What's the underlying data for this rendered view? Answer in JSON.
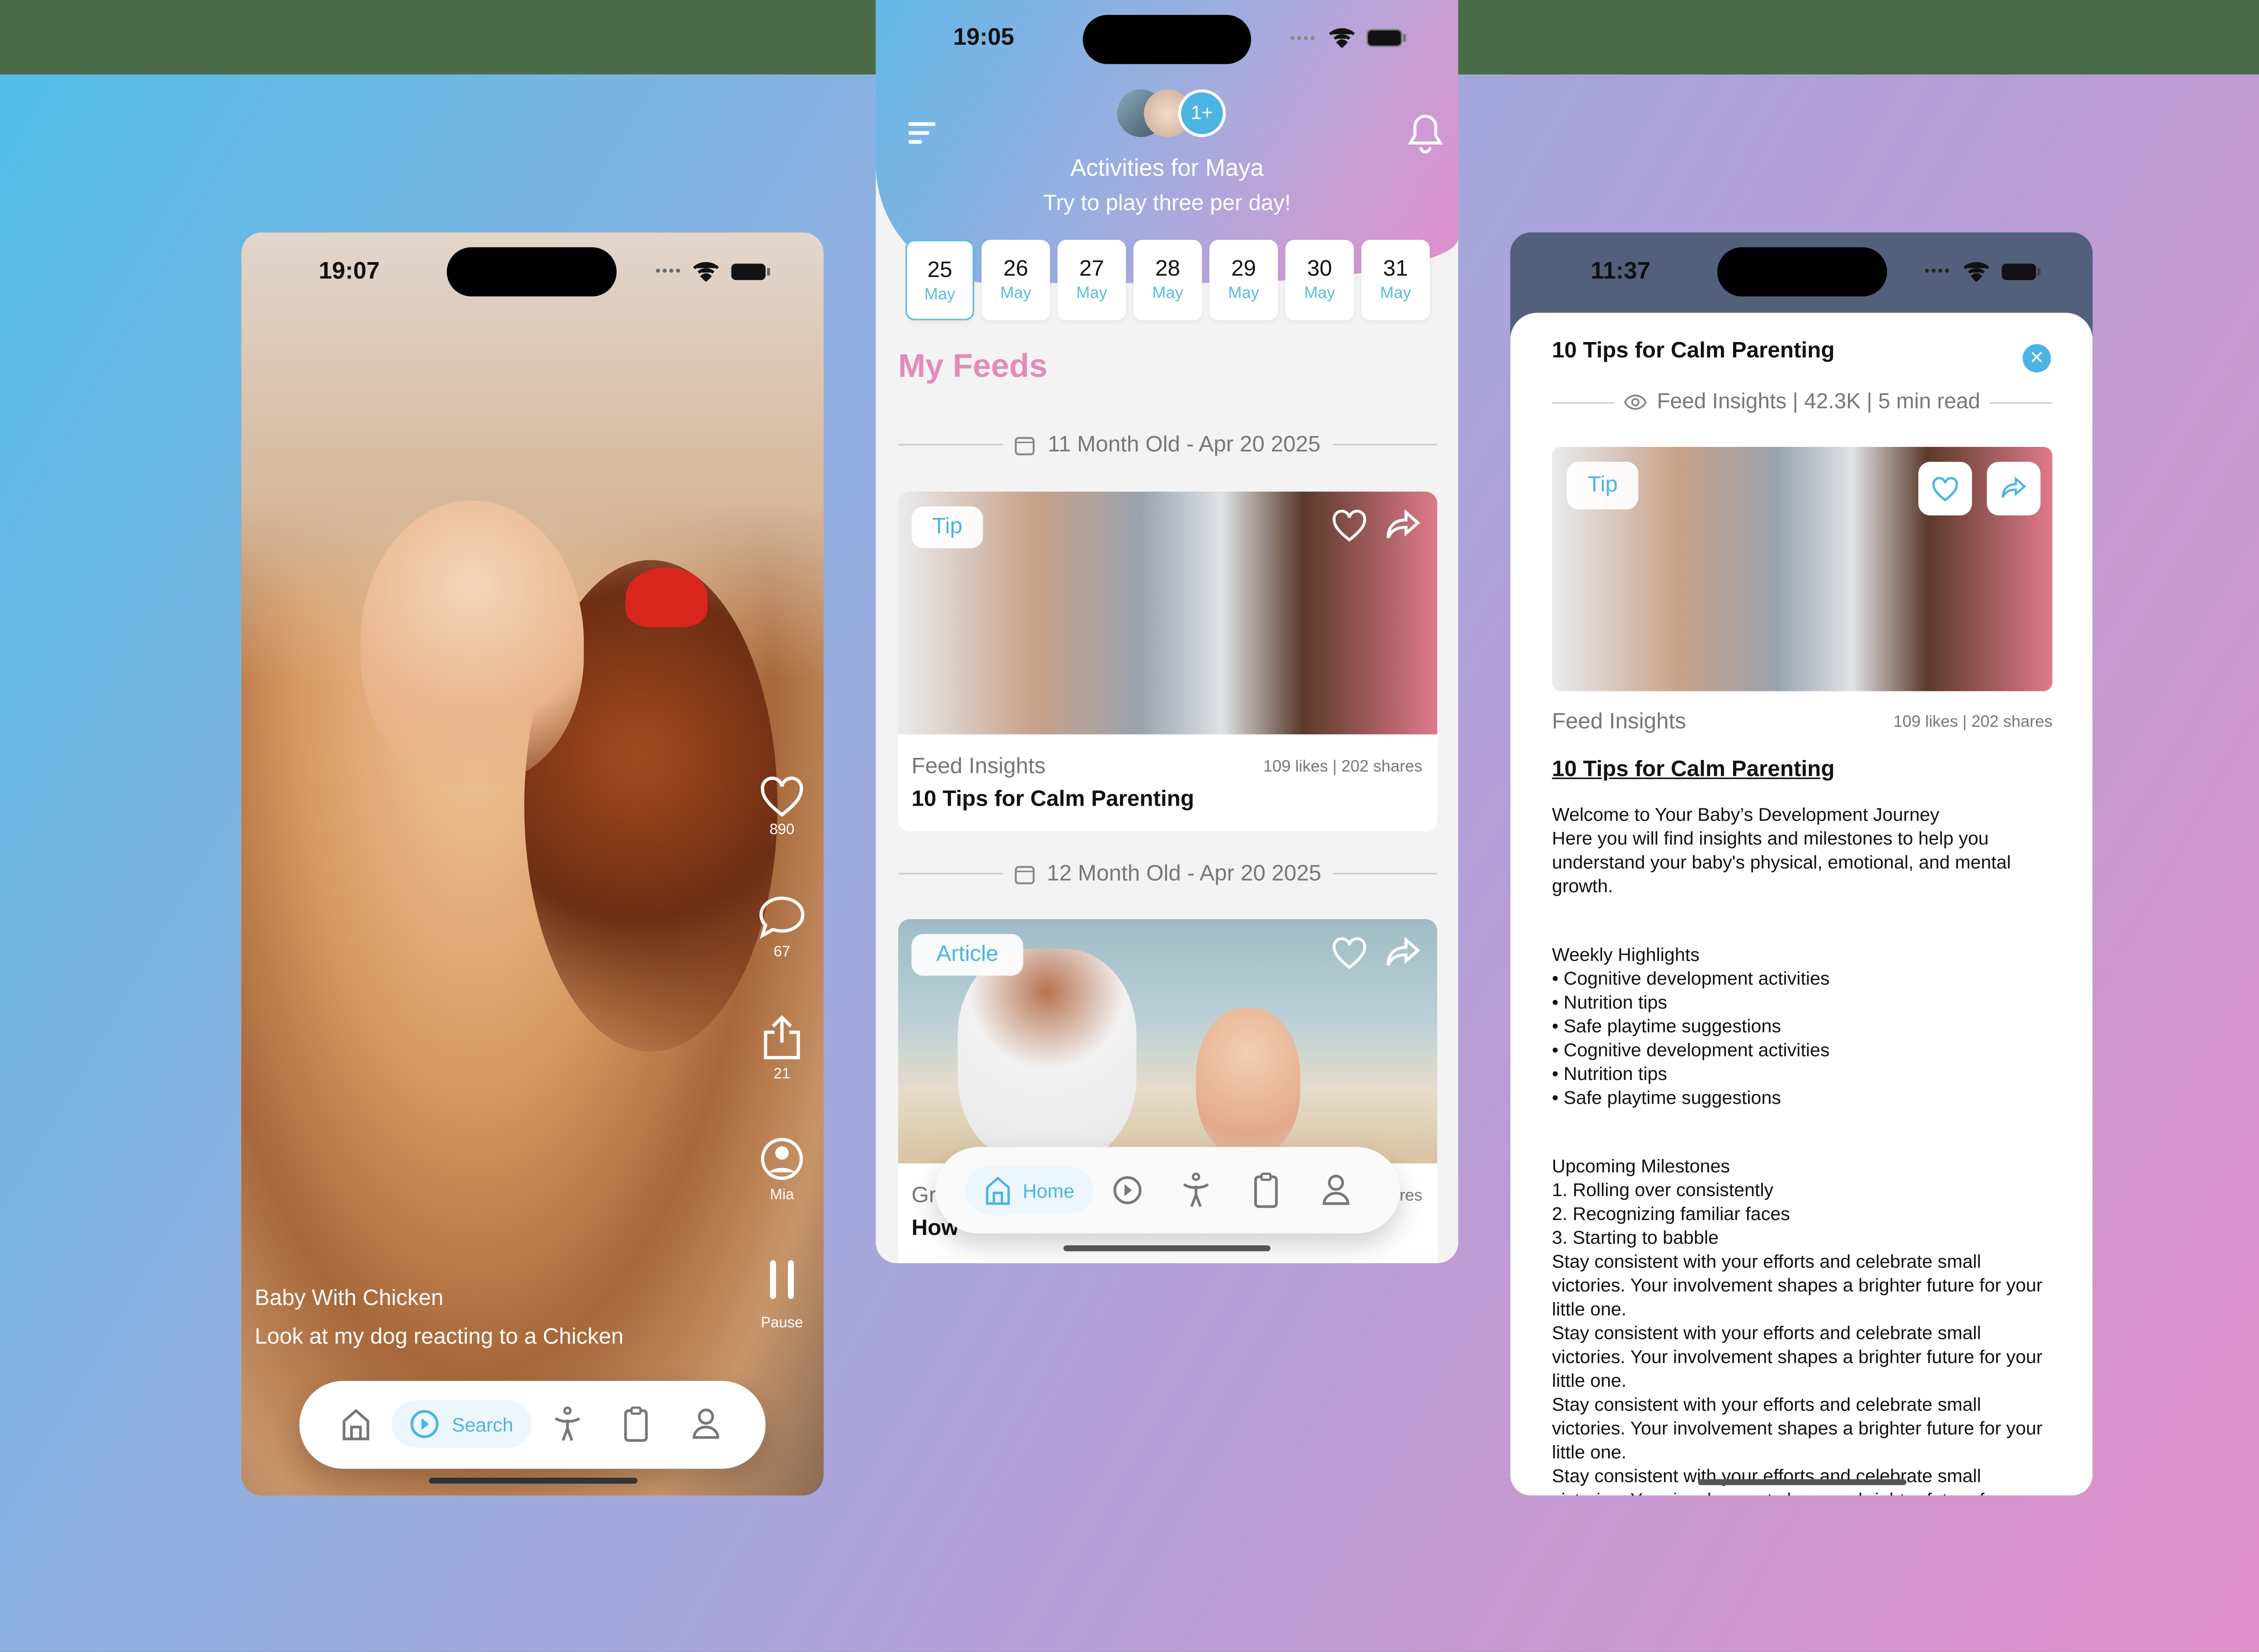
{
  "colors": {
    "accent": "#4cb4e2",
    "pink": "#e58bb9"
  },
  "video_screen": {
    "status_time": "19:07",
    "rail": {
      "likes": "890",
      "comments": "67",
      "shares": "21",
      "author": "Mia",
      "pause_label": "Pause"
    },
    "icons": [
      "heart-icon",
      "comment-icon",
      "share-icon",
      "user-circle-icon",
      "pause-icon"
    ],
    "title": "Baby With Chicken",
    "description": "Look at my dog reacting to a Chicken",
    "nav": {
      "active": "Search",
      "items": [
        "home",
        "play",
        "activities",
        "clipboard",
        "profile"
      ]
    }
  },
  "feed_screen": {
    "status_time": "19:05",
    "avatar_more": "1+",
    "title": "Activities for Maya",
    "subtitle": "Try to play three per day!",
    "dates": [
      {
        "day": "25",
        "month": "May",
        "selected": true
      },
      {
        "day": "26",
        "month": "May"
      },
      {
        "day": "27",
        "month": "May"
      },
      {
        "day": "28",
        "month": "May"
      },
      {
        "day": "29",
        "month": "May"
      },
      {
        "day": "30",
        "month": "May"
      },
      {
        "day": "31",
        "month": "May"
      }
    ],
    "section_title": "My Feeds",
    "groups": [
      {
        "label": "11 Month Old - Apr 20 2025",
        "card": {
          "badge": "Tip",
          "category": "Feed Insights",
          "stats": "109 likes | 202 shares",
          "title": "10 Tips for Calm Parenting"
        }
      },
      {
        "label": "12 Month Old - Apr 20 2025",
        "card": {
          "badge": "Article",
          "category_fragment": "Gr",
          "stats_fragment": "res",
          "title_fragment": "How"
        }
      }
    ],
    "nav": {
      "active": "Home",
      "items": [
        "home",
        "play",
        "activities",
        "clipboard",
        "profile"
      ]
    }
  },
  "detail_screen": {
    "status_time": "11:37",
    "title": "10 Tips for Calm Parenting",
    "meta": "Feed Insights | 42.3K | 5 min read",
    "badge": "Tip",
    "category": "Feed Insights",
    "stats": "109 likes | 202 shares",
    "link_title": "10 Tips for Calm Parenting",
    "intro": [
      "Welcome to Your Baby’s Development Journey",
      "Here you will find insights and milestones to help you understand your baby's physical, emotional, and mental growth."
    ],
    "highlights_title": "Weekly Highlights",
    "highlights": [
      "• Cognitive development activities",
      "• Nutrition tips",
      "• Safe playtime suggestions",
      "• Cognitive development activities",
      "• Nutrition tips",
      "• Safe playtime suggestions"
    ],
    "milestones_title": "Upcoming Milestones",
    "milestones": [
      "1. Rolling over consistently",
      "2. Recognizing familiar faces",
      "3. Starting to babble"
    ],
    "closing": [
      "Stay consistent with your efforts and celebrate small victories. Your involvement shapes a brighter future for your little one.",
      "Stay consistent with your efforts and celebrate small victories. Your involvement shapes a brighter future for your little one.",
      "Stay consistent with your efforts and celebrate small victories. Your involvement shapes a brighter future for your little one.",
      "Stay consistent with your efforts and celebrate small victories. Your involvement shapes a brighter future for"
    ]
  }
}
